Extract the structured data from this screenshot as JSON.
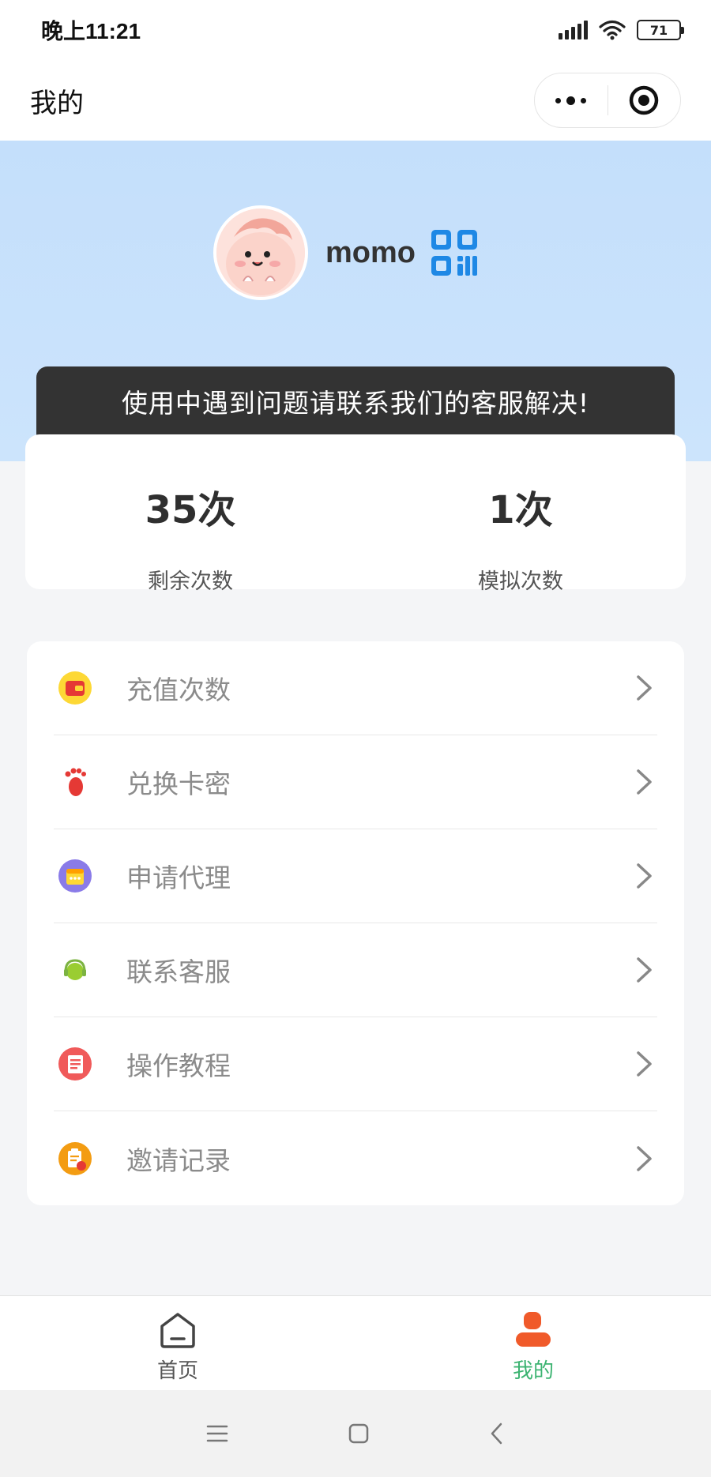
{
  "status_bar": {
    "time": "晚上11:21",
    "battery": "71"
  },
  "nav": {
    "title": "我的"
  },
  "profile": {
    "username": "momo"
  },
  "notice": {
    "text": "使用中遇到问题请联系我们的客服解决!"
  },
  "stats": [
    {
      "value": "35次",
      "label": "剩余次数"
    },
    {
      "value": "1次",
      "label": "模拟次数"
    }
  ],
  "menu": [
    {
      "label": "充值次数",
      "icon": "wallet-icon",
      "color": "#f5a623"
    },
    {
      "label": "兑换卡密",
      "icon": "footprint-icon",
      "color": "#e53935"
    },
    {
      "label": "申请代理",
      "icon": "calendar-icon",
      "color": "#7b68ee"
    },
    {
      "label": "联系客服",
      "icon": "headset-icon",
      "color": "#9acd32"
    },
    {
      "label": "操作教程",
      "icon": "document-icon",
      "color": "#f05a5a"
    },
    {
      "label": "邀请记录",
      "icon": "clipboard-icon",
      "color": "#f39c12"
    }
  ],
  "tabs": [
    {
      "label": "首页",
      "icon": "home-icon",
      "active": false
    },
    {
      "label": "我的",
      "icon": "user-icon",
      "active": true
    }
  ],
  "colors": {
    "accent": "#3cb371",
    "hero_bg": "#c4dffb",
    "notice_bg": "#333333",
    "qr": "#1e88e5"
  }
}
